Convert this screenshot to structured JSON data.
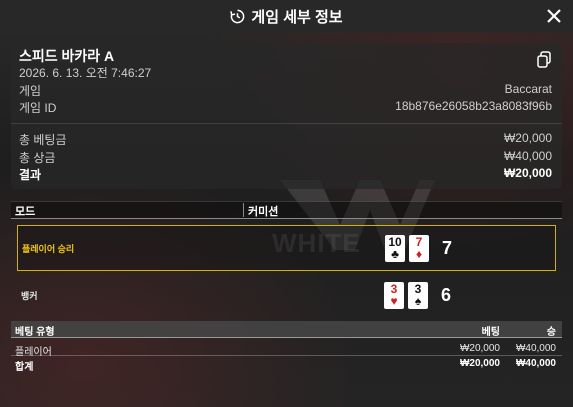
{
  "header": {
    "title": "게임 세부 정보"
  },
  "summary": {
    "game_title": "스피드 바카라 A",
    "datetime": "2026. 6. 13. 오전 7:46:27",
    "game_label": "게임",
    "game_value": "Baccarat",
    "game_id_label": "게임 ID",
    "game_id_value": "18b876e26058b23a8083f96b",
    "total_bet_label": "총 베팅금",
    "total_bet_value": "₩20,000",
    "total_win_label": "총 상금",
    "total_win_value": "₩40,000",
    "result_label": "결과",
    "result_value": "₩20,000"
  },
  "mode_table": {
    "col_mode": "모드",
    "col_commission": "커미션"
  },
  "outcomes": [
    {
      "name": "플레이어 승리",
      "cards": [
        {
          "rank": "10",
          "suit": "♣",
          "color": "black"
        },
        {
          "rank": "7",
          "suit": "♦",
          "color": "red"
        }
      ],
      "score": "7"
    },
    {
      "name": "뱅커",
      "cards": [
        {
          "rank": "3",
          "suit": "♥",
          "color": "red"
        },
        {
          "rank": "3",
          "suit": "♠",
          "color": "black"
        }
      ],
      "score": "6"
    }
  ],
  "bets": {
    "col_type": "베팅 유형",
    "col_bet": "베팅",
    "col_win": "승",
    "rows": [
      {
        "type": "플레이어",
        "bet": "₩20,000",
        "win": "₩40,000"
      }
    ],
    "total": {
      "type": "합계",
      "bet": "₩20,000",
      "win": "₩40,000"
    }
  },
  "colors": {
    "winner_border": "#d4b106",
    "winner_text": "#f0c419",
    "red_suit": "#d21f1f"
  }
}
